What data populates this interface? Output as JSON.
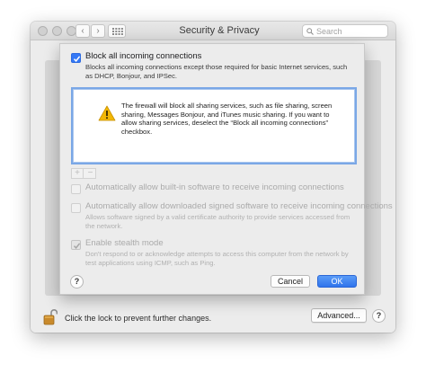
{
  "window": {
    "title": "Security & Privacy",
    "back_glyph": "‹",
    "forward_glyph": "›",
    "search_placeholder": "Search"
  },
  "firewall_options": {
    "block_all": {
      "label": "Block all incoming connections",
      "checked": true,
      "description": "Blocks all incoming connections except those required for basic Internet services, such as DHCP, Bonjour, and IPSec."
    },
    "info_message": "The firewall will block all sharing services, such as file sharing, screen sharing, Messages Bonjour, and iTunes music sharing. If you want to allow sharing services, deselect the “Block all incoming connections” checkbox.",
    "app_list_controls": {
      "add_label": "+",
      "remove_label": "−"
    },
    "allow_builtin": {
      "label": "Automatically allow built-in software to receive incoming connections",
      "checked": false,
      "disabled": true
    },
    "allow_signed": {
      "label": "Automatically allow downloaded signed software to receive incoming connections",
      "checked": false,
      "disabled": true,
      "description": "Allows software signed by a valid certificate authority to provide services accessed from the network."
    },
    "stealth_mode": {
      "label": "Enable stealth mode",
      "checked": true,
      "disabled": true,
      "description": "Don't respond to or acknowledge attempts to access this computer from the network by test applications using ICMP, such as Ping."
    },
    "help_label": "?",
    "cancel_label": "Cancel",
    "ok_label": "OK"
  },
  "footer": {
    "lock_text": "Click the lock to prevent further changes.",
    "advanced_label": "Advanced...",
    "help_label": "?"
  },
  "colors": {
    "accent": "#3478f6",
    "warning": "#f2b705"
  },
  "icons": [
    "close-dot-icon",
    "minimize-dot-icon",
    "zoom-dot-icon",
    "back-chevron-icon",
    "forward-chevron-icon",
    "grid-icon",
    "search-icon",
    "warning-icon",
    "lock-open-icon",
    "checkmark-icon"
  ]
}
